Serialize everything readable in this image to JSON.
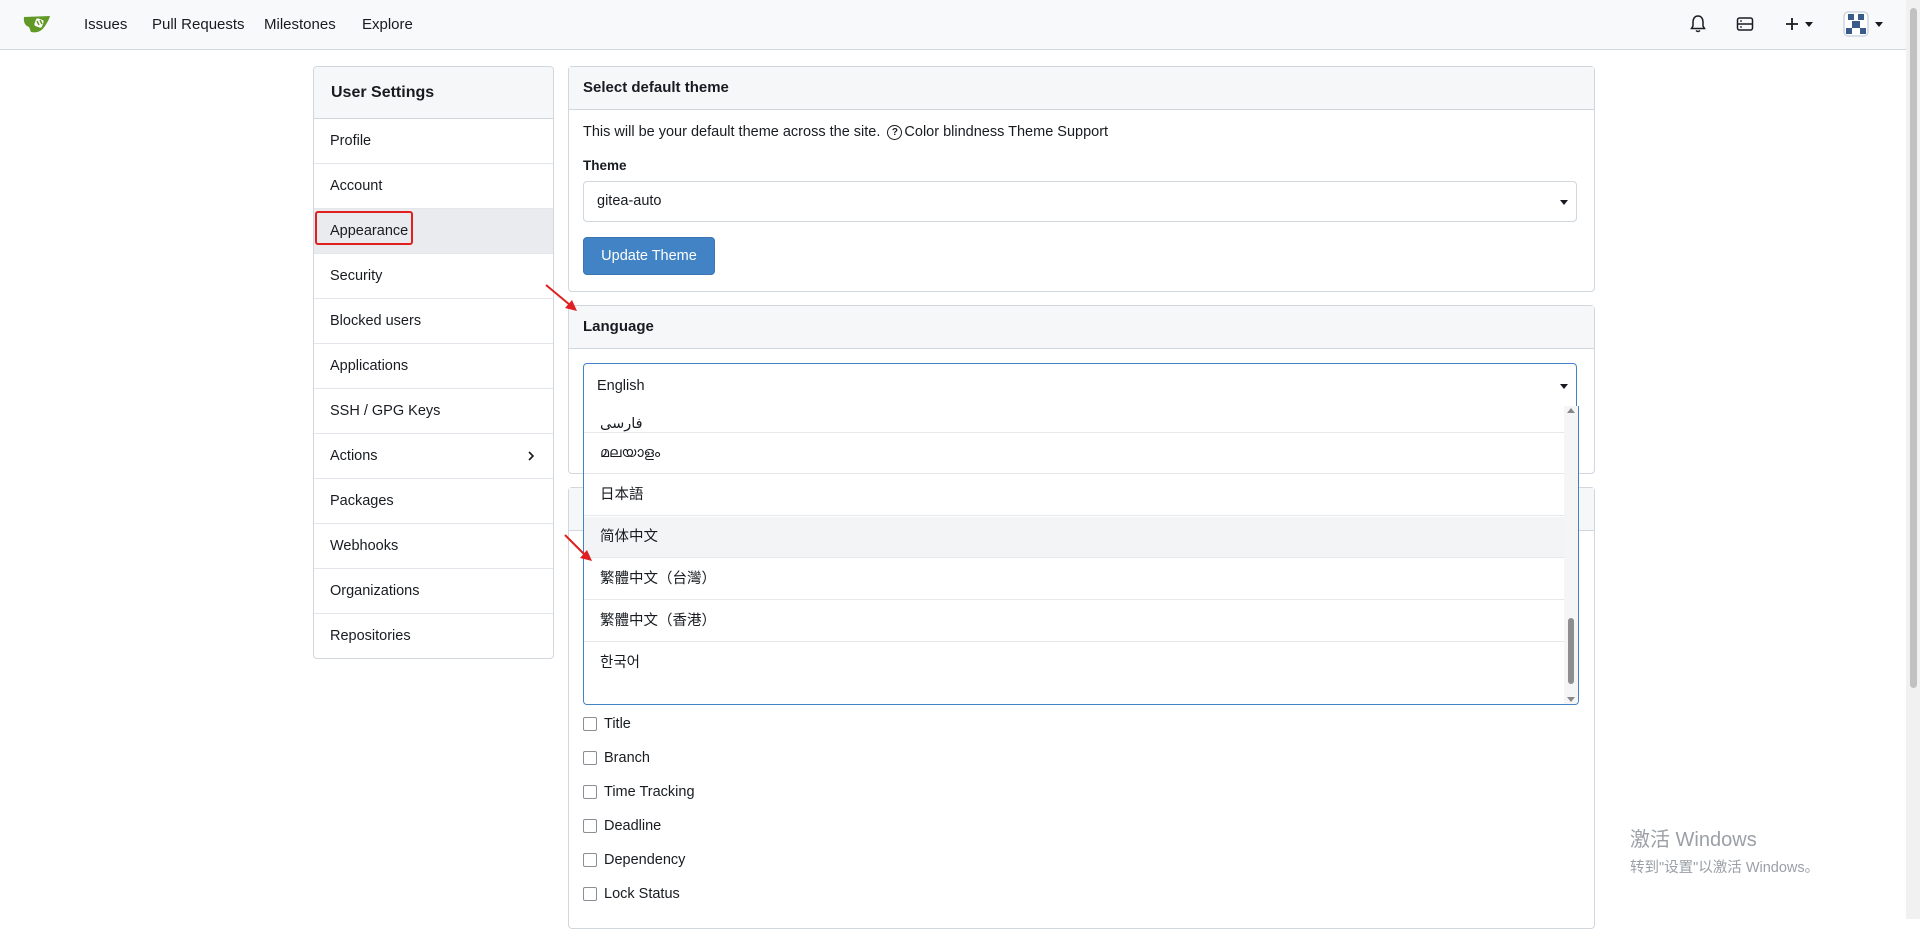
{
  "navbar": {
    "links": [
      "Issues",
      "Pull Requests",
      "Milestones",
      "Explore"
    ]
  },
  "sidebar": {
    "title": "User Settings",
    "items": [
      {
        "label": "Profile"
      },
      {
        "label": "Account"
      },
      {
        "label": "Appearance"
      },
      {
        "label": "Security"
      },
      {
        "label": "Blocked users"
      },
      {
        "label": "Applications"
      },
      {
        "label": "SSH / GPG Keys"
      },
      {
        "label": "Actions"
      },
      {
        "label": "Packages"
      },
      {
        "label": "Webhooks"
      },
      {
        "label": "Organizations"
      },
      {
        "label": "Repositories"
      }
    ]
  },
  "theme_panel": {
    "title": "Select default theme",
    "description": "This will be your default theme across the site.",
    "help_link": "Color blindness Theme Support",
    "field_label": "Theme",
    "selected": "gitea-auto",
    "button": "Update Theme"
  },
  "language_panel": {
    "title": "Language",
    "selected": "English",
    "options": [
      "فارسی",
      "മലയാളം",
      "日本語",
      "简体中文",
      "繁體中文（台灣）",
      "繁體中文（香港）",
      "한국어"
    ]
  },
  "checkboxes": [
    "Title",
    "Branch",
    "Time Tracking",
    "Deadline",
    "Dependency",
    "Lock Status"
  ],
  "watermark": {
    "title": "激活 Windows",
    "subtitle": "转到\"设置\"以激活 Windows。"
  },
  "colors": {
    "accent": "#4183c4",
    "highlight": "#e02020"
  }
}
